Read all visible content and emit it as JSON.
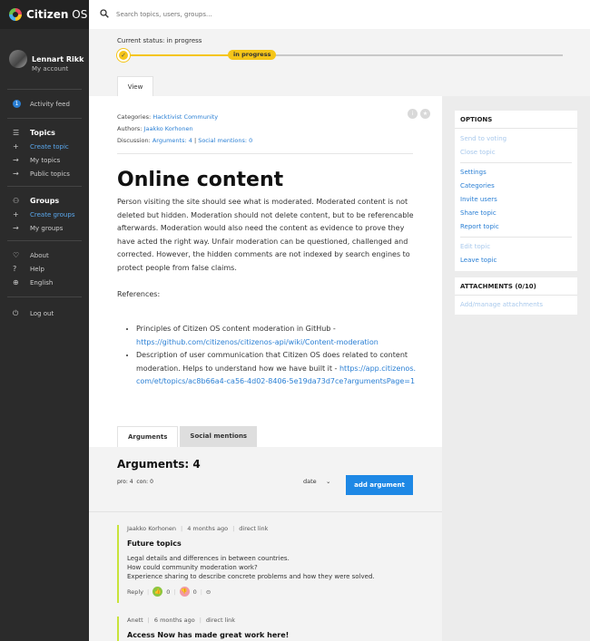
{
  "app": {
    "logo_bold": "Citizen",
    "logo_light": " OS"
  },
  "search": {
    "placeholder": "Search topics, users, groups..."
  },
  "profile": {
    "name": "Lennart Rikk",
    "sub": "My account"
  },
  "sidebar": {
    "activity": {
      "badge": "1",
      "label": "Activity feed"
    },
    "topics": {
      "label": "Topics",
      "create": "Create topic",
      "mine": "My topics",
      "public": "Public topics"
    },
    "groups": {
      "label": "Groups",
      "create": "Create groups",
      "mine": "My groups"
    },
    "about": "About",
    "help": "Help",
    "language": "English",
    "logout": "Log out"
  },
  "status": {
    "text": "Current status: in progress",
    "pill": "in progress",
    "progress_fraction": 0.25
  },
  "tabs": {
    "view": "View"
  },
  "meta": {
    "categories_label": "Categories:",
    "categories_value": "Hacktivist Community",
    "authors_label": "Authors:",
    "authors_value": "Jaakko Korhonen",
    "discussion_label": "Discussion:",
    "arguments_link": "Arguments: 4",
    "pipe": " | ",
    "social_link": "Social mentions: 0"
  },
  "topic": {
    "title": "Online content",
    "body": "Person visiting the site should see what is moderated. Moderated content is not deleted but hidden. Moderation should not delete content, but to be referencable afterwards. Moderation would also need the content as evidence to prove they have acted the right way. Unfair moderation can be questioned, challenged and corrected. However, the hidden comments are not indexed by search engines to protect people from false claims.",
    "references_label": "References:",
    "refs": [
      {
        "text": "Principles of Citizen OS content moderation in GitHub - ",
        "link": "https://github.com/citizenos/citizenos-api/wiki/Content-moderation"
      },
      {
        "text": "Description of user communication that Citizen OS does related to content moderation. Helps to understand how we have built it - ",
        "link": "https://app.citizenos.com/et/topics/ac8b66a4-ca56-4d02-8406-5e19da73d7ce?argumentsPage=1"
      }
    ]
  },
  "options": {
    "title": "OPTIONS",
    "send_to_voting": "Send to voting",
    "close_topic": "Close topic",
    "settings": "Settings",
    "categories": "Categories",
    "invite_users": "Invite users",
    "share_topic": "Share topic",
    "report_topic": "Report topic",
    "edit_topic": "Edit topic",
    "leave_topic": "Leave topic"
  },
  "attachments": {
    "title": "ATTACHMENTS (0/10)",
    "manage": "Add/manage attachments"
  },
  "argtabs": {
    "arguments": "Arguments",
    "social": "Social mentions"
  },
  "arguments": {
    "title": "Arguments: 4",
    "pro": "pro: 4",
    "con": "con: 0",
    "sort": "date",
    "add": "add argument",
    "items": [
      {
        "author": "Jaakko Korhonen",
        "time": "4 months ago",
        "link": "direct link",
        "title": "Future topics",
        "lines": [
          "Legal details and differences in between countries.",
          "How could community moderation work?",
          "Experience sharing to describe concrete problems and how they were solved."
        ],
        "reply": "Reply",
        "up": "0",
        "down": "0"
      },
      {
        "author": "Anett",
        "time": "6 months ago",
        "link": "direct link",
        "title": "Access Now has made great work here!"
      }
    ]
  }
}
